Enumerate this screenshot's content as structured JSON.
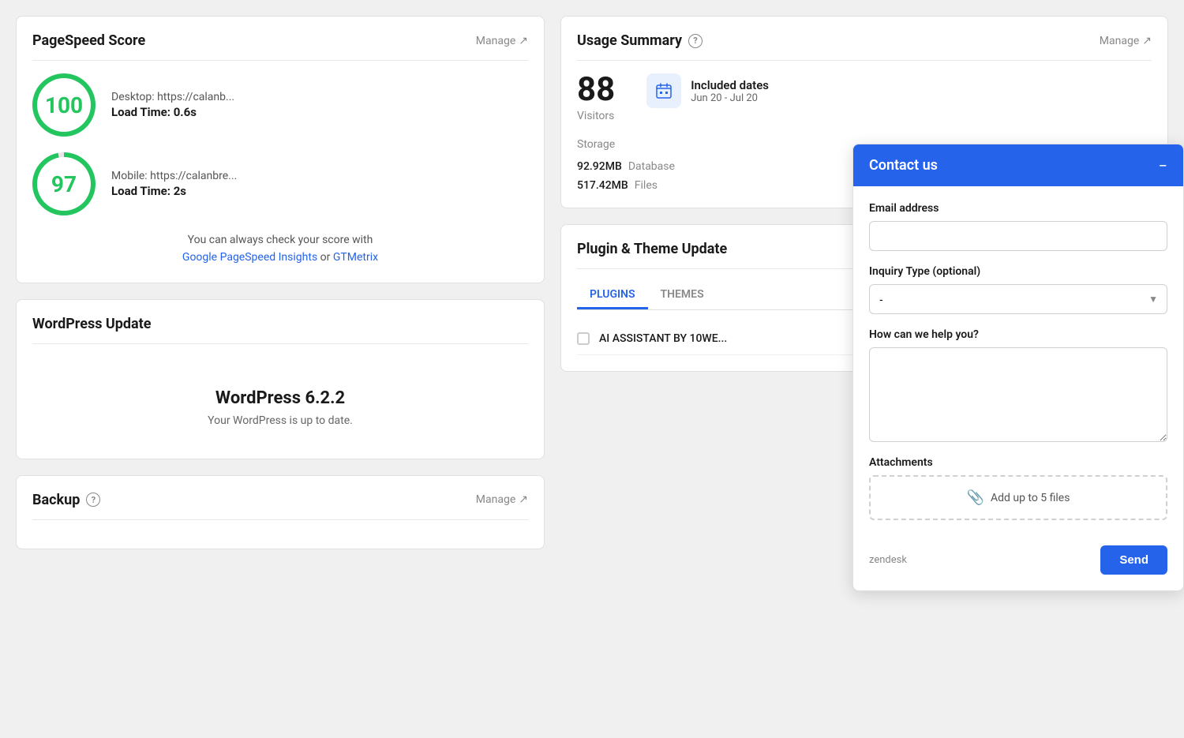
{
  "left": {
    "pagespeed": {
      "title": "PageSpeed Score",
      "manage_label": "Manage",
      "desktop": {
        "score": "100",
        "url": "Desktop: https://calanb...",
        "load_time": "Load Time: 0.6s"
      },
      "mobile": {
        "score": "97",
        "url": "Mobile: https://calanbre...",
        "load_time": "Load Time: 2s"
      },
      "footer_text": "You can always check your score with",
      "link1_text": "Google PageSpeed Insights",
      "or_text": " or ",
      "link2_text": "GTMetrix"
    },
    "wp_update": {
      "title": "WordPress Update",
      "version": "WordPress 6.2.2",
      "status": "Your WordPress is up to date."
    },
    "backup": {
      "title": "Backup",
      "manage_label": "Manage"
    }
  },
  "right": {
    "usage_summary": {
      "title": "Usage Summary",
      "manage_label": "Manage",
      "visitors_count": "88",
      "visitors_label": "Visitors",
      "dates_title": "Included dates",
      "dates_range": "Jun 20 - Jul 20",
      "storage_label": "Storage",
      "database_value": "92.92MB",
      "database_label": "Database",
      "files_value": "517.42MB",
      "files_label": "Files"
    },
    "plugin_theme": {
      "title": "Plugin & Theme Update",
      "tab_plugins": "PLUGINS",
      "tab_themes": "THEMES",
      "plugin_item": "AI ASSISTANT BY 10WE..."
    }
  },
  "contact_panel": {
    "title": "Contact us",
    "close_label": "−",
    "email_label": "Email address",
    "email_placeholder": "",
    "inquiry_label": "Inquiry Type (optional)",
    "inquiry_default": "-",
    "help_label": "How can we help you?",
    "help_placeholder": "",
    "attachments_label": "Attachments",
    "attachments_text": "Add up to 5 files",
    "zendesk_label": "zendesk",
    "send_label": "Send"
  }
}
